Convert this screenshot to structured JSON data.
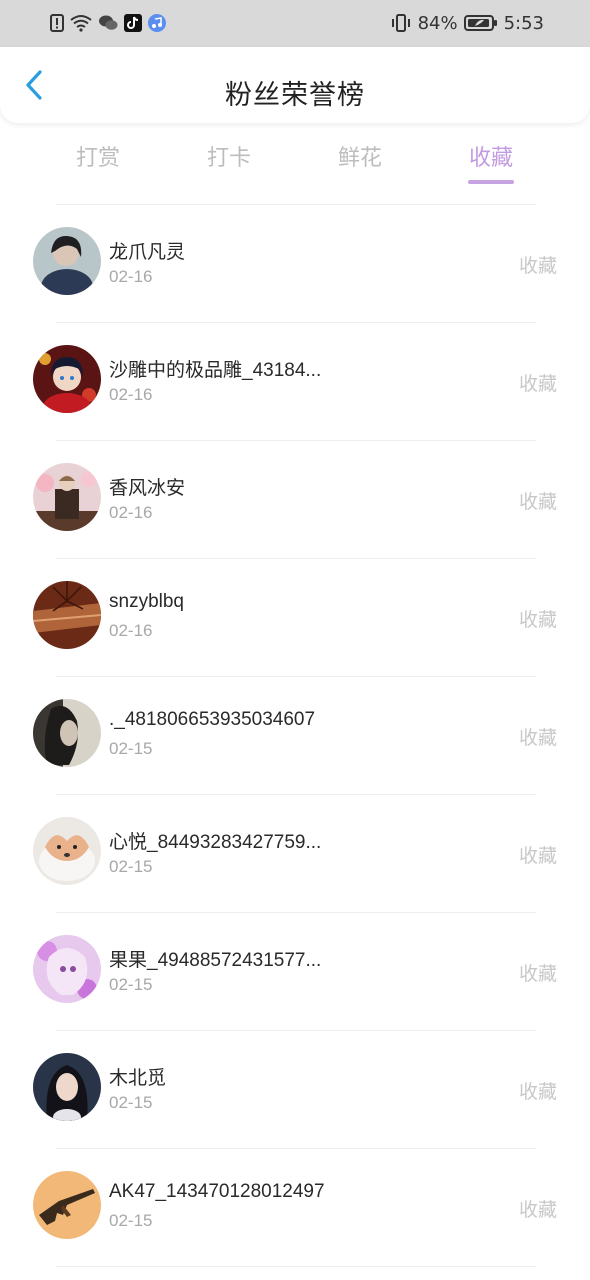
{
  "status_bar": {
    "battery": "84%",
    "time": "5:53"
  },
  "header": {
    "title": "粉丝荣誉榜"
  },
  "tabs": [
    {
      "label": "打赏",
      "active": false
    },
    {
      "label": "打卡",
      "active": false
    },
    {
      "label": "鲜花",
      "active": false
    },
    {
      "label": "收藏",
      "active": true
    }
  ],
  "colors": {
    "accent": "#c39be0",
    "muted": "#bdbdbd"
  },
  "list": [
    {
      "name": "龙爪凡灵",
      "date": "02-16",
      "action": "收藏",
      "avatar": "avatar-1"
    },
    {
      "name": "沙雕中的极品雕_43184...",
      "date": "02-16",
      "action": "收藏",
      "avatar": "avatar-2"
    },
    {
      "name": "香风冰安",
      "date": "02-16",
      "action": "收藏",
      "avatar": "avatar-3"
    },
    {
      "name": "snzyblbq",
      "date": "02-16",
      "action": "收藏",
      "avatar": "avatar-4"
    },
    {
      "name": "._481806653935034607",
      "date": "02-15",
      "action": "收藏",
      "avatar": "avatar-5"
    },
    {
      "name": "心悦_84493283427759...",
      "date": "02-15",
      "action": "收藏",
      "avatar": "avatar-6"
    },
    {
      "name": "果果_49488572431577...",
      "date": "02-15",
      "action": "收藏",
      "avatar": "avatar-7"
    },
    {
      "name": "木北觅",
      "date": "02-15",
      "action": "收藏",
      "avatar": "avatar-8"
    },
    {
      "name": "AK47_143470128012497",
      "date": "02-15",
      "action": "收藏",
      "avatar": "avatar-9"
    }
  ]
}
